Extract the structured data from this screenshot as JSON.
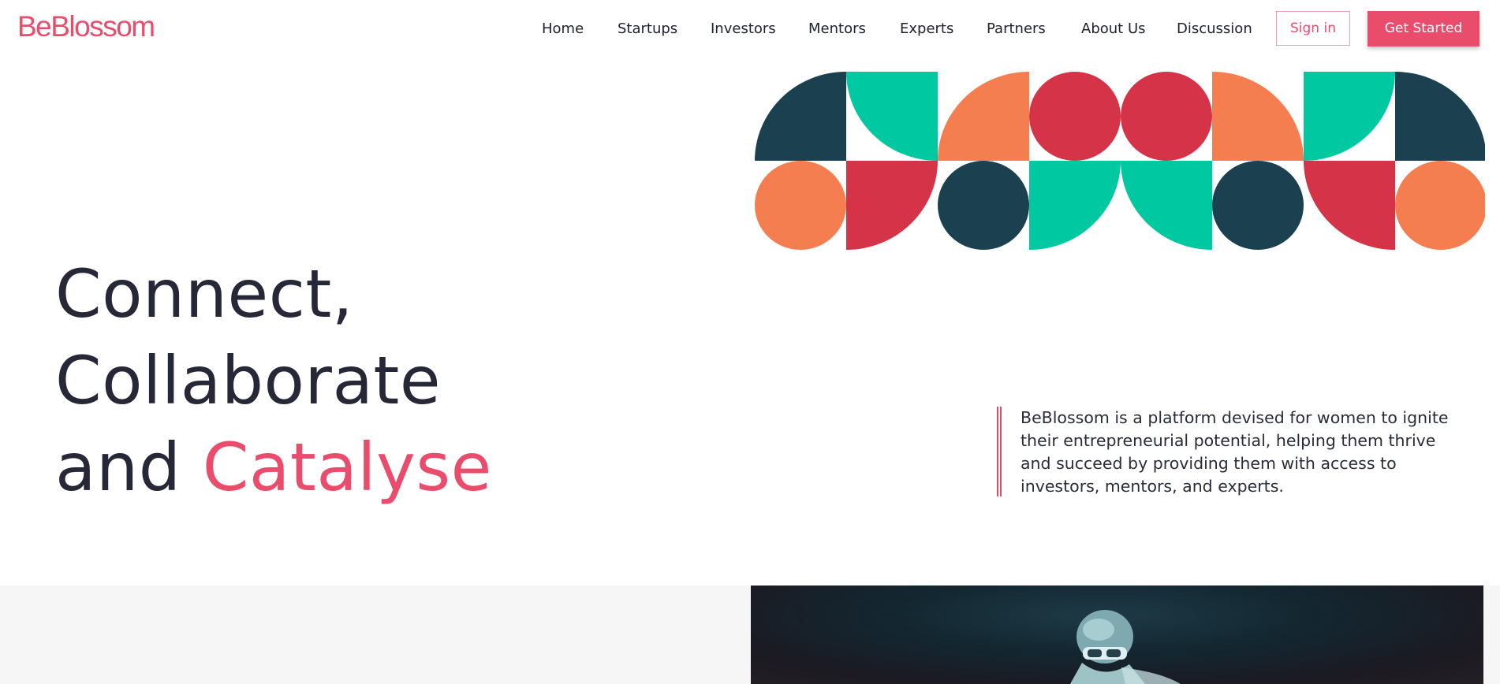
{
  "brand": {
    "name": "BeBlossom",
    "accent_color": "#ea4c6c"
  },
  "nav": {
    "items": [
      {
        "label": "Home"
      },
      {
        "label": "Startups"
      },
      {
        "label": "Investors"
      },
      {
        "label": "Mentors"
      },
      {
        "label": "Experts"
      },
      {
        "label": "Partners"
      },
      {
        "label": "About Us"
      },
      {
        "label": "Discussion"
      }
    ],
    "signin_label": "Sign in",
    "get_started_label": "Get Started"
  },
  "hero": {
    "line1": "Connect,",
    "line2": "Collaborate",
    "line3_prefix": "and",
    "line3_accent": "Catalyse",
    "text_color": "#262837",
    "description": "BeBlossom is a platform devised for women to ignite their entrepreneurial potential, helping them thrive and succeed by providing them with access to investors, mentors, and experts."
  },
  "pattern": {
    "colors": {
      "navy": "#1b4150",
      "teal": "#00c8a0",
      "orange": "#f57e50",
      "red": "#d53347"
    }
  },
  "lower": {
    "background": "#f6f6f7",
    "media": "video-still-helmet-rider"
  }
}
